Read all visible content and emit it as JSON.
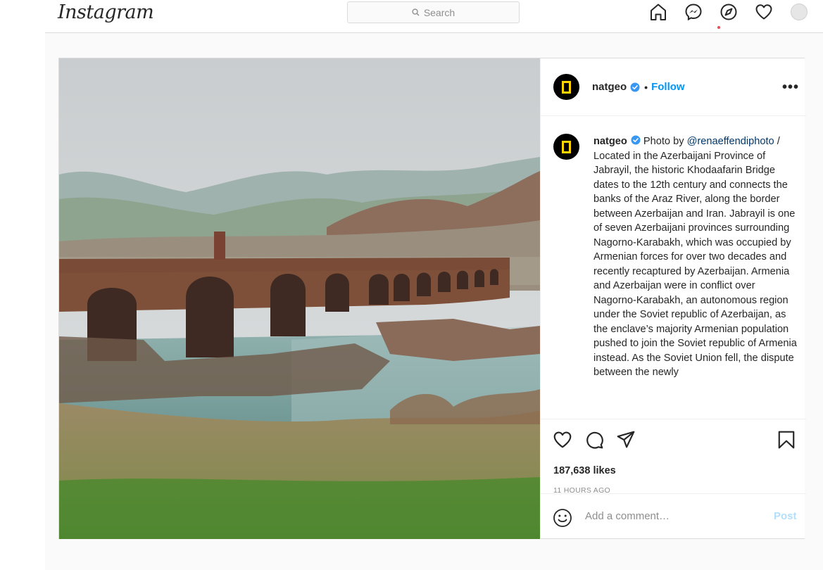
{
  "app": {
    "logo": "Instagram"
  },
  "search": {
    "placeholder": "Search"
  },
  "nav": {
    "icons": [
      "home-icon",
      "messenger-icon",
      "explore-icon",
      "activity-heart-icon",
      "profile-avatar"
    ]
  },
  "post": {
    "username": "natgeo",
    "verified": true,
    "separator": "•",
    "follow_label": "Follow",
    "more_label": "•••",
    "caption": {
      "username": "natgeo",
      "intro": " Photo by ",
      "mention": "@renaeffendiphoto",
      "text": " / Located in the Azerbaijani Province of Jabrayil, the historic Khodaafarin Bridge dates to the 12th century and connects the banks of the Araz River, along the border between Azerbaijan and Iran. Jabrayil is one of seven Azerbaijani provinces surrounding Nagorno-Karabakh, which was occupied by Armenian forces for over two decades and recently recaptured by Azerbaijan. Armenia and Azerbaijan were in conflict over Nagorno-Karabakh, an autonomous region under the Soviet republic of Azerbaijan, as the enclave’s majority Armenian population pushed to join the Soviet republic of Armenia instead. As the Soviet Union fell, the dispute between the newly"
    },
    "likes": "187,638 likes",
    "timestamp": "11 HOURS AGO",
    "comment_placeholder": "Add a comment…",
    "post_button": "Post"
  },
  "colors": {
    "accent": "#0095f6",
    "verified": "#3897f0",
    "mention": "#00376b",
    "post_disabled": "#b2dffc",
    "notification": "#ed4956",
    "natgeo_yellow": "#ffd500"
  }
}
